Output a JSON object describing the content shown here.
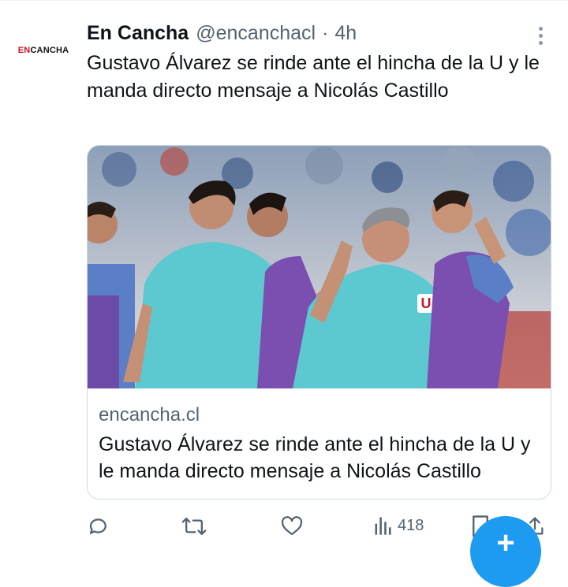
{
  "tweet": {
    "avatar_logo_prefix": "EN",
    "avatar_logo_suffix": "CANCHA",
    "author_name": "En Cancha",
    "handle": "@encanchacl",
    "separator": "·",
    "time": "4h",
    "text": "Gustavo Álvarez se rinde ante el hincha de la U y le manda directo mensaje a Nicolás Castillo"
  },
  "card": {
    "domain": "encancha.cl",
    "title": "Gustavo Álvarez se rinde ante el hincha de la U y le manda directo mensaje a Nicolás Castillo",
    "image_description": "photo-soccer-coach-high-five"
  },
  "actions": {
    "reply_icon": "reply-icon",
    "retweet_icon": "retweet-icon",
    "like_icon": "heart-icon",
    "views_icon": "views-icon",
    "views_count": "418",
    "bookmark_icon": "bookmark-icon",
    "share_icon": "share-icon"
  },
  "fab": {
    "label": "+",
    "icon": "compose-icon"
  },
  "colors": {
    "accent": "#1d9bf0",
    "secondary_text": "#536471",
    "border": "#cfd9de",
    "logo_red": "#d8101a",
    "jersey_teal": "#5cc8cf",
    "jersey_purple": "#7a4fb0"
  }
}
